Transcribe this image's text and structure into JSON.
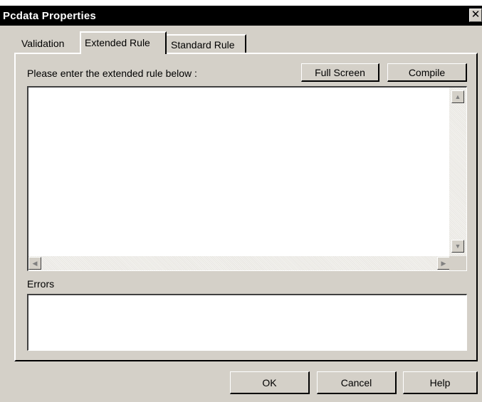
{
  "window": {
    "title": "Pcdata Properties",
    "close_glyph": "✕"
  },
  "tabs": [
    {
      "label": "Validation"
    },
    {
      "label": "Extended Rule",
      "selected": true
    },
    {
      "label": "Standard Rule"
    }
  ],
  "extended_rule": {
    "prompt": "Please enter the extended rule below :",
    "full_screen_label": "Full Screen",
    "compile_label": "Compile",
    "rule_text": ""
  },
  "errors": {
    "label": "Errors",
    "text": ""
  },
  "footer": {
    "ok_label": "OK",
    "cancel_label": "Cancel",
    "help_label": "Help"
  },
  "icons": {
    "up": "▲",
    "down": "▼",
    "left": "◀",
    "right": "▶"
  },
  "colors": {
    "dialog_face": "#d4d0c8",
    "title_bar": "#000000"
  }
}
